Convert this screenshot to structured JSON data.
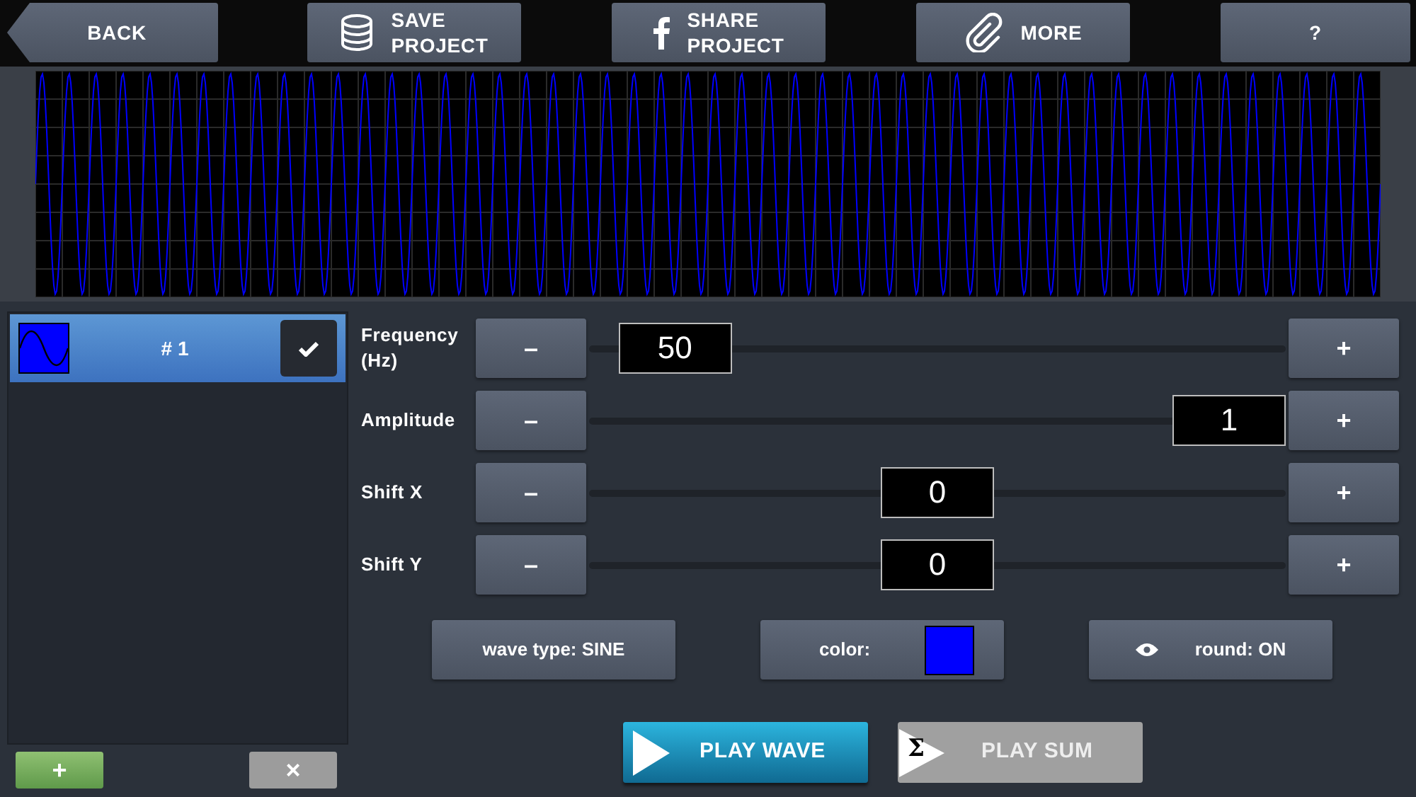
{
  "toolbar": [
    {
      "kind": "back",
      "label": "BACK"
    },
    {
      "kind": "save",
      "label": "SAVE\nPROJECT"
    },
    {
      "kind": "share",
      "label": "SHARE\nPROJECT"
    },
    {
      "kind": "more",
      "label": "MORE"
    },
    {
      "kind": "help",
      "label": "?"
    }
  ],
  "waves": [
    {
      "label": "# 1",
      "color": "#0000ff",
      "selected": true,
      "checked": true
    }
  ],
  "wave_list_buttons": {
    "add": "+",
    "delete": "×"
  },
  "parameters": [
    {
      "label": "Frequency\n(Hz)",
      "minus": "–",
      "plus": "+",
      "value": "50",
      "level": 0.05
    },
    {
      "label": "Amplitude",
      "minus": "–",
      "plus": "+",
      "value": "1",
      "level": 1
    },
    {
      "label": "Shift X",
      "minus": "–",
      "plus": "+",
      "value": "0",
      "level": 0.5
    },
    {
      "label": "Shift Y",
      "minus": "–",
      "plus": "+",
      "value": "0",
      "level": 0.5
    }
  ],
  "options": {
    "wave_type": "wave type: SINE",
    "color_label": "color:",
    "color": "#0000ff",
    "round": "round: ON"
  },
  "play_wave": "PLAY WAVE",
  "play_sum": {
    "icon": "Σ",
    "label": "PLAY SUM",
    "disabled": true
  }
}
